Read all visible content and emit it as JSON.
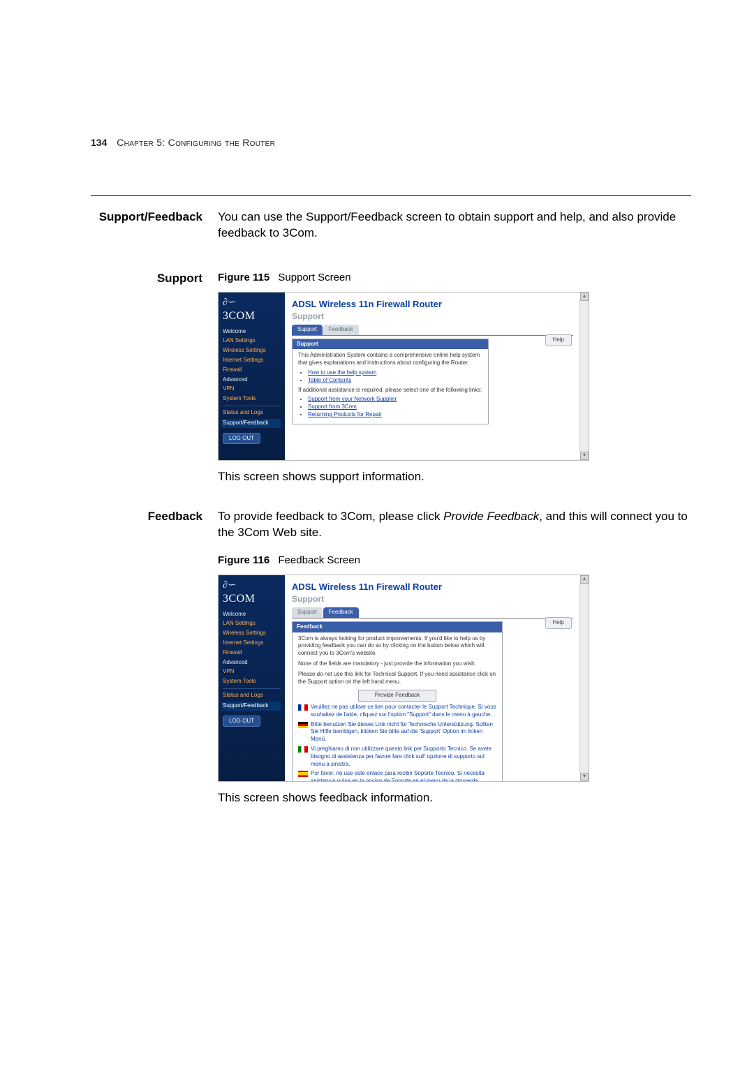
{
  "page": {
    "number": "134",
    "chapter": "Chapter 5: Configuring the Router"
  },
  "sec": {
    "heading": "Support/Feedback",
    "intro": "You can use the Support/Feedback screen to obtain support and help, and also provide feedback to 3Com."
  },
  "support": {
    "heading": "Support",
    "fig_label": "Figure 115",
    "fig_caption": "Support Screen",
    "after": "This screen shows support information."
  },
  "feedback": {
    "heading": "Feedback",
    "intro_a": "To provide feedback to 3Com, please click ",
    "intro_em": "Provide Feedback",
    "intro_b": ", and this will connect you to the 3Com Web site.",
    "fig_label": "Figure 116",
    "fig_caption": "Feedback Screen",
    "after": "This screen shows feedback information."
  },
  "shot": {
    "logo": "3COM",
    "router_title": "ADSL Wireless 11n Firewall Router",
    "page_title": "Support",
    "help_btn": "Help",
    "logout": "LOG OUT",
    "tabs": {
      "support": "Support",
      "feedback": "Feedback"
    },
    "nav": {
      "welcome": "Welcome",
      "lan": "LAN Settings",
      "wireless": "Wireless Settings",
      "internet": "Internet Settings",
      "firewall": "Firewall",
      "advanced": "Advanced",
      "vpn": "VPN",
      "tools": "System Tools",
      "status": "Status and Logs",
      "supfb": "Support/Feedback"
    },
    "support_panel": {
      "head": "Support",
      "p1": "This Administration System contains a comprehensive online help system that gives explanations and instructions about configuring the Router.",
      "li1": "How to use the help system",
      "li2": "Table of Contents",
      "p2": "If additional assistance is required, please select one of the following links:",
      "li3": "Support from your Network Supplier",
      "li4": "Support from 3Com",
      "li5": "Returning Products for Repair"
    },
    "feedback_panel": {
      "head": "Feedback",
      "p1": "3Com is always looking for product improvements. If you'd like to help us by providing feedback you can do so by clicking on the button below which will connect you to 3Com's website.",
      "p2": "None of the fields are mandatory - just provide the information you wish.",
      "p3": "Please do not use this link for Technical Support. If you need assistance click on the Support option on the left hand menu.",
      "btn": "Provide Feedback",
      "fr": "Veuillez ne pas utiliser ce lien pour contacter le Support Technique. Si vous souhaitez de l'aide, cliquez sur l'option \"Support\" dans le menu à gauche.",
      "de": "Bitte benutzen Sie dieses Link nicht für Technische Unterstützung. Sollten Sie Hilfe benötigen, klicken Sie bitte auf die 'Support' Option im linken Menü.",
      "it": "Vi preghiamo di non utilizzare questo link per Supporto Tecnico. Se avete bisogno di assistenza per favore fare click sull' opzione di supporto sul menu a sinistra.",
      "es": "Por favor, no use este enlace para recibir Soporte Tecnico. Si necesita asistencia pulse en la opcion de Soporte en el menu de la izquierda."
    }
  }
}
